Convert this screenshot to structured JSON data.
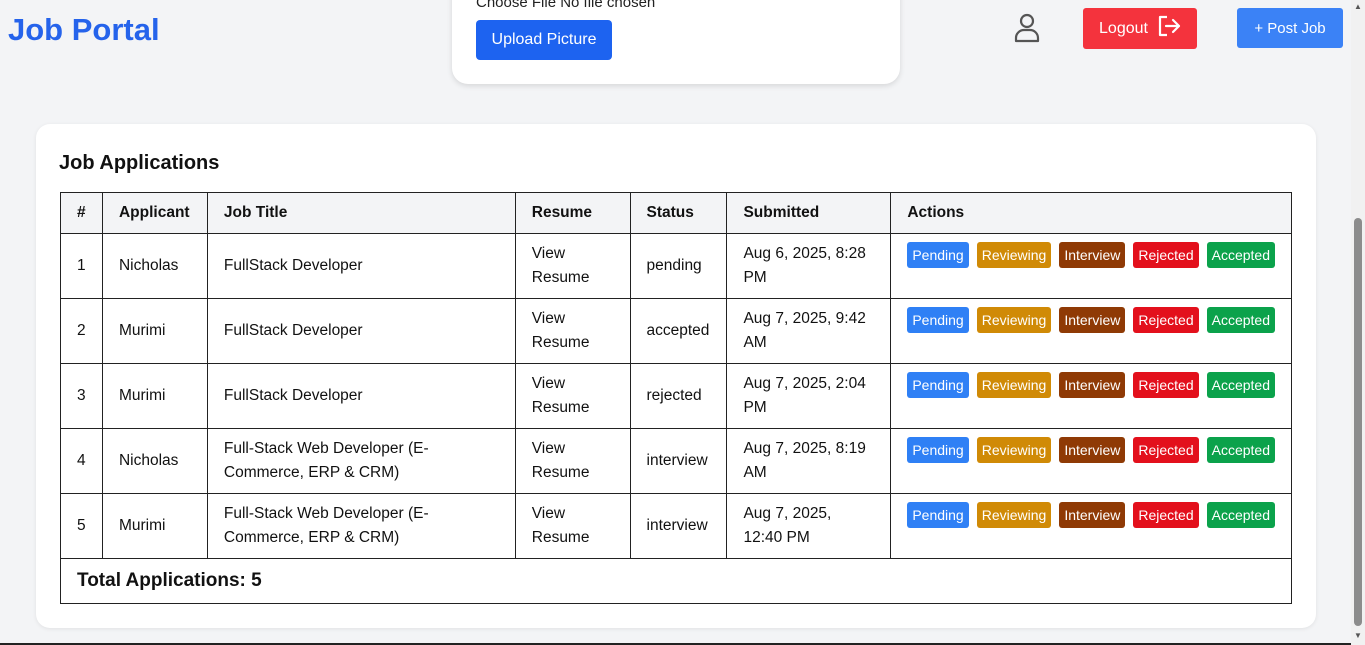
{
  "header": {
    "brand": "Job Portal",
    "file_status": "Choose File No file chosen",
    "upload_label": "Upload Picture",
    "logout_label": "Logout",
    "post_job_label": "+ Post Job",
    "icons": {
      "user": "user-icon",
      "logout": "logout-icon"
    },
    "colors": {
      "brand": "#2563eb",
      "logout": "#f4333d",
      "post_job": "#3b82f6",
      "upload": "#1d63f0"
    }
  },
  "applications": {
    "title": "Job Applications",
    "columns": [
      "#",
      "Applicant",
      "Job Title",
      "Resume",
      "Status",
      "Submitted",
      "Actions"
    ],
    "action_buttons": [
      {
        "label": "Pending",
        "color": "#2f80f5"
      },
      {
        "label": "Reviewing",
        "color": "#d08a06"
      },
      {
        "label": "Interview",
        "color": "#8f3a05"
      },
      {
        "label": "Rejected",
        "color": "#e3101c"
      },
      {
        "label": "Accepted",
        "color": "#0ba24b"
      }
    ],
    "rows": [
      {
        "num": "1",
        "applicant": "Nicholas",
        "job_title": "FullStack Developer",
        "resume": "View Resume",
        "status": "pending",
        "submitted": "Aug 6, 2025, 8:28 PM"
      },
      {
        "num": "2",
        "applicant": "Murimi",
        "job_title": "FullStack Developer",
        "resume": "View Resume",
        "status": "accepted",
        "submitted": "Aug 7, 2025, 9:42 AM"
      },
      {
        "num": "3",
        "applicant": "Murimi",
        "job_title": "FullStack Developer",
        "resume": "View Resume",
        "status": "rejected",
        "submitted": "Aug 7, 2025, 2:04 PM"
      },
      {
        "num": "4",
        "applicant": "Nicholas",
        "job_title": "Full-Stack Web Developer (E-Commerce, ERP & CRM)",
        "resume": "View Resume",
        "status": "interview",
        "submitted": "Aug 7, 2025, 8:19 AM"
      },
      {
        "num": "5",
        "applicant": "Murimi",
        "job_title": "Full-Stack Web Developer (E-Commerce, ERP & CRM)",
        "resume": "View Resume",
        "status": "interview",
        "submitted": "Aug 7, 2025, 12:40 PM"
      }
    ],
    "total_label": "Total Applications: 5"
  }
}
